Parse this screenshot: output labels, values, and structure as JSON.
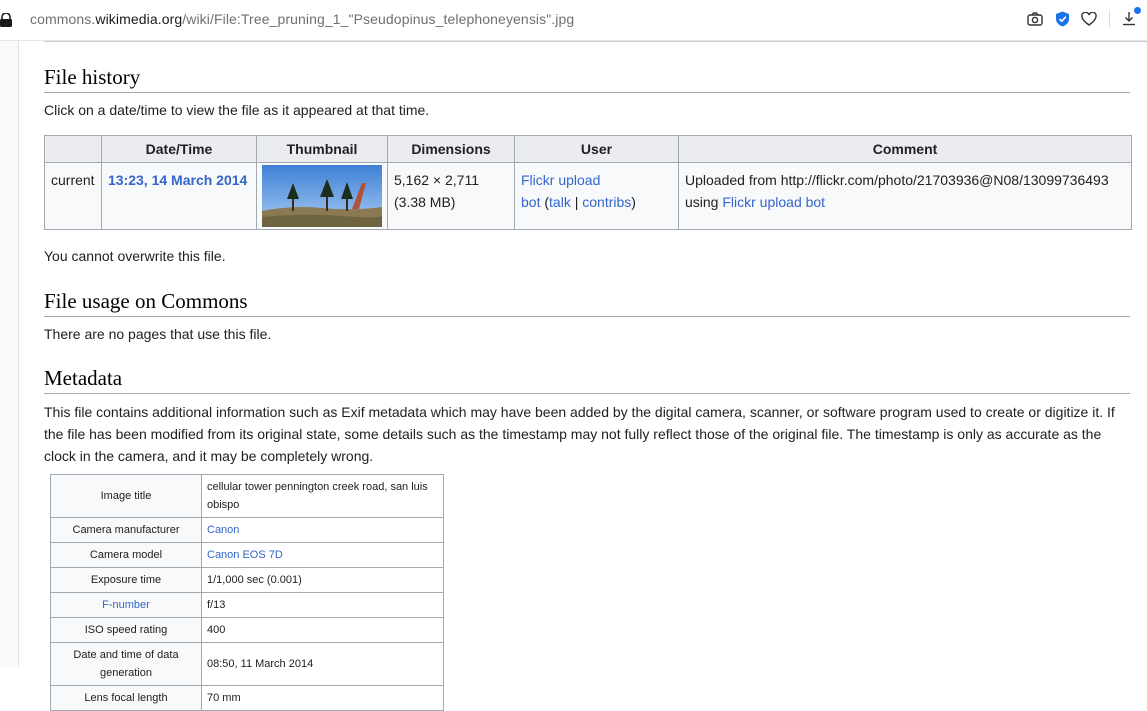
{
  "browser": {
    "url_prefix": "commons.",
    "url_domain": "wikimedia.org",
    "url_path": "/wiki/File:Tree_pruning_1_\"Pseudopinus_telephoneyensis\".jpg",
    "icons": [
      "camera-icon",
      "shield-icon",
      "heart-icon",
      "download-icon"
    ]
  },
  "file_history": {
    "heading": "File history",
    "intro": "Click on a date/time to view the file as it appeared at that time.",
    "columns": [
      "",
      "Date/Time",
      "Thumbnail",
      "Dimensions",
      "User",
      "Comment"
    ],
    "row": {
      "status": "current",
      "datetime": "13:23, 14 March 2014",
      "dimensions": "5,162 × 2,711",
      "size": "(3.38 MB)",
      "user_line1": "Flickr upload",
      "user_bot": "bot",
      "user_talk": "talk",
      "user_contribs": "contribs",
      "comment_text": "Uploaded from http://flickr.com/photo/21703936@N08/13099736493",
      "comment_using": "using",
      "comment_link": "Flickr upload bot"
    },
    "overwrite_note": "You cannot overwrite this file."
  },
  "file_usage": {
    "heading": "File usage on Commons",
    "text": "There are no pages that use this file."
  },
  "metadata": {
    "heading": "Metadata",
    "text": "This file contains additional information such as Exif metadata which may have been added by the digital camera, scanner, or software program used to create or digitize it. If the file has been modified from its original state, some details such as the timestamp may not fully reflect those of the original file. The timestamp is only as accurate as the clock in the camera, and it may be completely wrong.",
    "rows": [
      {
        "key": "Image title",
        "value": "cellular tower pennington creek road, san luis obispo"
      },
      {
        "key": "Camera manufacturer",
        "value": "Canon"
      },
      {
        "key": "Camera model",
        "value": "Canon EOS 7D"
      },
      {
        "key": "Exposure time",
        "value": "1/1,000 sec (0.001)"
      },
      {
        "key": "F-number",
        "value": "f/13"
      },
      {
        "key": "ISO speed rating",
        "value": "400"
      },
      {
        "key": "Date and time of data generation",
        "value": "08:50, 11 March 2014"
      },
      {
        "key": "Lens focal length",
        "value": "70 mm"
      }
    ]
  },
  "colors": {
    "link": "#3366cc",
    "header_bg": "#eaecf0",
    "cell_bg": "#f8f9fa",
    "border": "#a2a9b1"
  }
}
